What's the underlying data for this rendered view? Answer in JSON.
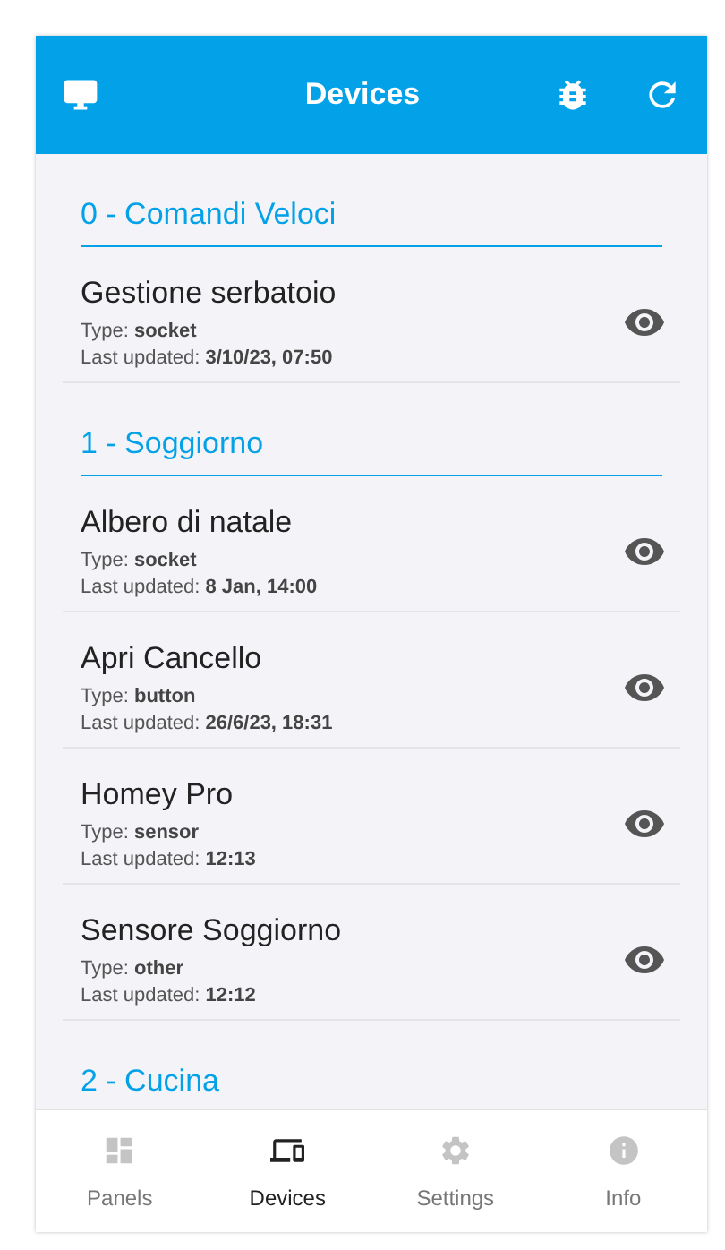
{
  "header": {
    "title": "Devices"
  },
  "sections": [
    {
      "title": "0 - Comandi Veloci",
      "devices": [
        {
          "name": "Gestione serbatoio",
          "type": "Type: **socket**",
          "updated": "Last updated: **3/10/23, 07:50**"
        }
      ]
    },
    {
      "title": "1 - Soggiorno",
      "devices": [
        {
          "name": "Albero di natale",
          "type": "Type: **socket**",
          "updated": "Last updated: **8 Jan, 14:00**"
        },
        {
          "name": "Apri Cancello",
          "type": "Type: **button**",
          "updated": "Last updated: **26/6/23, 18:31**"
        },
        {
          "name": "Homey Pro",
          "type": "Type: **sensor**",
          "updated": "Last updated: **12:13**"
        },
        {
          "name": "Sensore Soggiorno",
          "type": "Type: **other**",
          "updated": "Last updated: **12:12**"
        }
      ]
    },
    {
      "title": "2 - Cucina"
    }
  ],
  "nav": [
    {
      "kind": "panels",
      "label": "Panels",
      "selected": false
    },
    {
      "kind": "devices",
      "label": "Devices",
      "selected": true
    },
    {
      "kind": "settings",
      "label": "Settings",
      "selected": false
    },
    {
      "kind": "info",
      "label": "Info",
      "selected": false
    }
  ]
}
